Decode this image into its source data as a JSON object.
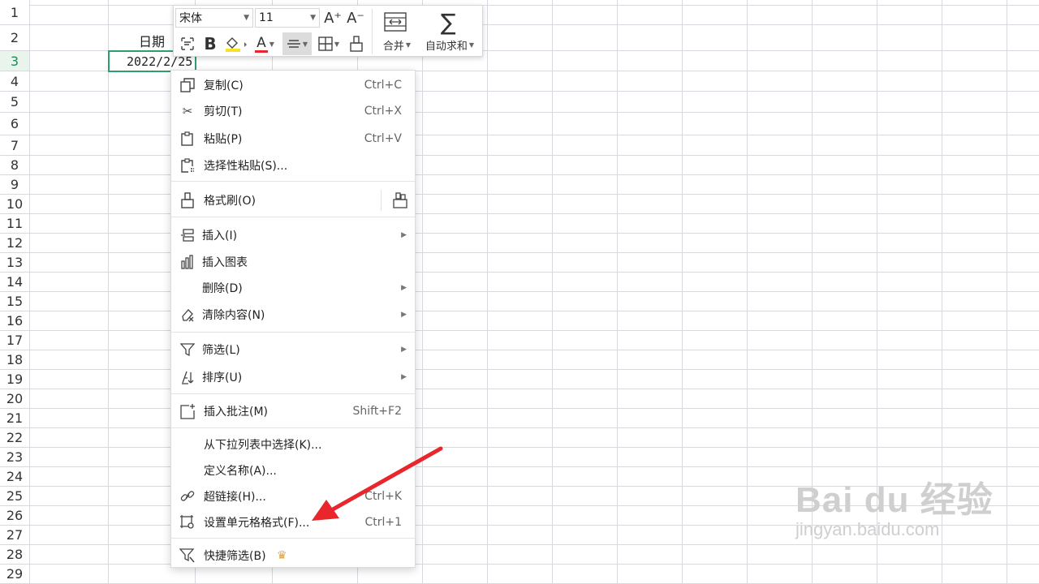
{
  "sheet": {
    "rows": [
      "1",
      "2",
      "3",
      "4",
      "5",
      "6",
      "7",
      "8",
      "9",
      "10",
      "11",
      "12",
      "13",
      "14",
      "15",
      "16",
      "17",
      "18",
      "19",
      "20",
      "21",
      "22",
      "23",
      "24",
      "25",
      "26",
      "27",
      "28",
      "29"
    ],
    "cell_header": "日期",
    "cell_value": "2022/2/25"
  },
  "mini_toolbar": {
    "font_name": "宋体",
    "font_size": "11",
    "increase_font": "A⁺",
    "decrease_font": "A⁻",
    "bold": "B",
    "font_color_letter": "A",
    "merge_label": "合并",
    "autosum_label": "自动求和"
  },
  "menu": {
    "copy": {
      "label": "复制(C)",
      "shortcut": "Ctrl+C"
    },
    "cut": {
      "label": "剪切(T)",
      "shortcut": "Ctrl+X"
    },
    "paste": {
      "label": "粘贴(P)",
      "shortcut": "Ctrl+V"
    },
    "paste_special": {
      "label": "选择性粘贴(S)..."
    },
    "format_painter": {
      "label": "格式刷(O)"
    },
    "insert": {
      "label": "插入(I)"
    },
    "insert_chart": {
      "label": "插入图表"
    },
    "delete": {
      "label": "删除(D)"
    },
    "clear": {
      "label": "清除内容(N)"
    },
    "filter": {
      "label": "筛选(L)"
    },
    "sort": {
      "label": "排序(U)"
    },
    "comment": {
      "label": "插入批注(M)",
      "shortcut": "Shift+F2"
    },
    "pick_list": {
      "label": "从下拉列表中选择(K)..."
    },
    "define_name": {
      "label": "定义名称(A)..."
    },
    "hyperlink": {
      "label": "超链接(H)...",
      "shortcut": "Ctrl+K"
    },
    "format_cells": {
      "label": "设置单元格格式(F)...",
      "shortcut": "Ctrl+1"
    },
    "quick_filter": {
      "label": "快捷筛选(B)"
    }
  },
  "watermark": {
    "brand": "Bai du 经验",
    "url": "jingyan.baidu.com"
  },
  "colors": {
    "accent_green": "#2f9e6e",
    "arrow_red": "#e8262b",
    "crown": "#f0a020"
  }
}
